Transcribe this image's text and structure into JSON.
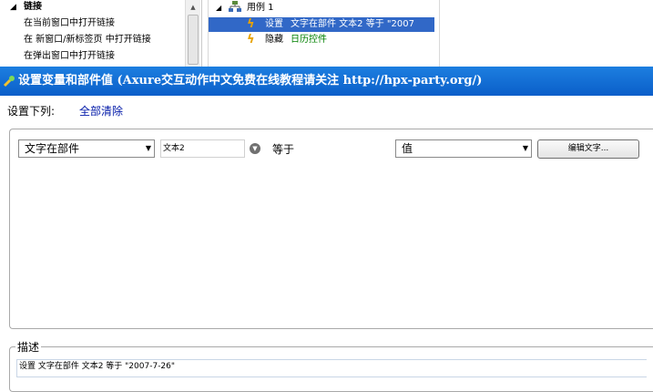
{
  "actions_list": {
    "items": [
      "链接",
      "在当前窗口中打开链接",
      "在 新窗口/新标签页 中打开链接",
      "在弹出窗口中打开链接"
    ]
  },
  "case_tree": {
    "case_label": "用例 1",
    "actions": [
      {
        "prefix": "设置",
        "text": "文字在部件 文本2 等于 \"2007"
      },
      {
        "prefix": "隐藏",
        "text": "日历控件"
      }
    ]
  },
  "dialog": {
    "title": "设置变量和部件值 (Axure交互动作中文免费在线教程请关注 http://hpx-party.org/)",
    "set_below_label": "设置下列:",
    "clear_all": "全部清除",
    "target_type": "文字在部件",
    "target_widget": "文本2",
    "equals_label": "等于",
    "value_type": "值",
    "edit_text_button": "编辑文字...",
    "description_legend": "描述",
    "description_text": "设置 文字在部件 文本2 等于 \"2007-7-26\""
  },
  "icons": {
    "title": "wrench-icon",
    "case": "flow-icon",
    "action": "lightning-icon"
  }
}
